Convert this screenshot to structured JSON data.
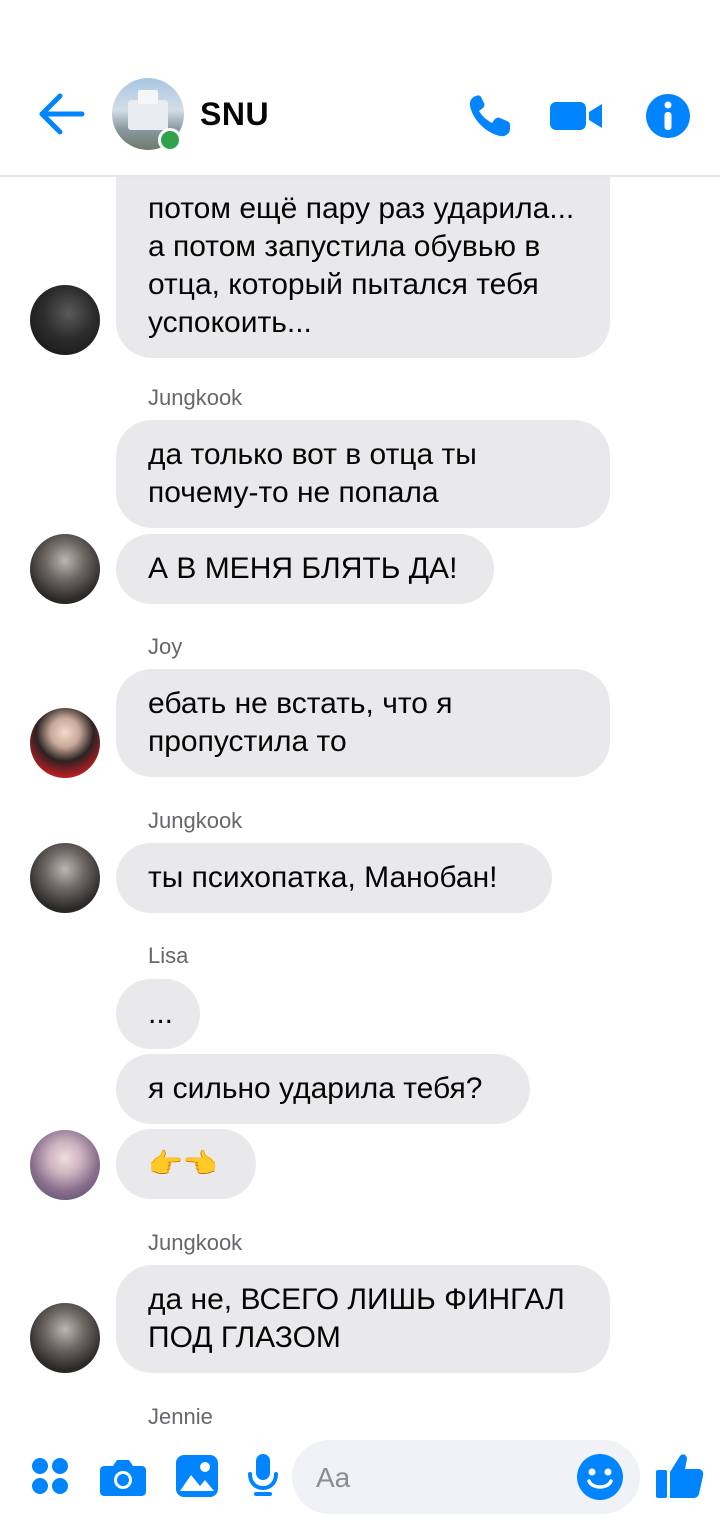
{
  "header": {
    "title": "SNU",
    "icons": [
      "back-arrow-icon",
      "group-avatar",
      "phone-icon",
      "video-camera-icon",
      "info-icon"
    ],
    "accent": "#0084ff",
    "online_color": "#31a24c"
  },
  "messages": [
    {
      "sender": "",
      "text": "потом ещё пару раз ударила... а потом запустила обувью в отца, который пытался тебя успокоить..."
    },
    {
      "sender": "Jungkook",
      "text": "да только вот в отца ты почему-то не попала"
    },
    {
      "sender": "",
      "text": "А В МЕНЯ БЛЯТЬ ДА!"
    },
    {
      "sender": "Joy",
      "text": "ебать не встать, что я пропустила то"
    },
    {
      "sender": "Jungkook",
      "text": "ты психопатка, Манобан!"
    },
    {
      "sender": "Lisa",
      "text": "..."
    },
    {
      "sender": "",
      "text": "я сильно ударила тебя?"
    },
    {
      "sender": "",
      "text": "👉👈"
    },
    {
      "sender": "Jungkook",
      "text": "да не, ВСЕГО ЛИШЬ ФИНГАЛ ПОД ГЛАЗОМ"
    },
    {
      "sender": "Jennie",
      "text": ""
    }
  ],
  "composer": {
    "placeholder": "Aa",
    "icons": [
      "apps-icon",
      "camera-icon",
      "gallery-icon",
      "microphone-icon",
      "emoji-icon",
      "thumbs-up-icon"
    ]
  }
}
